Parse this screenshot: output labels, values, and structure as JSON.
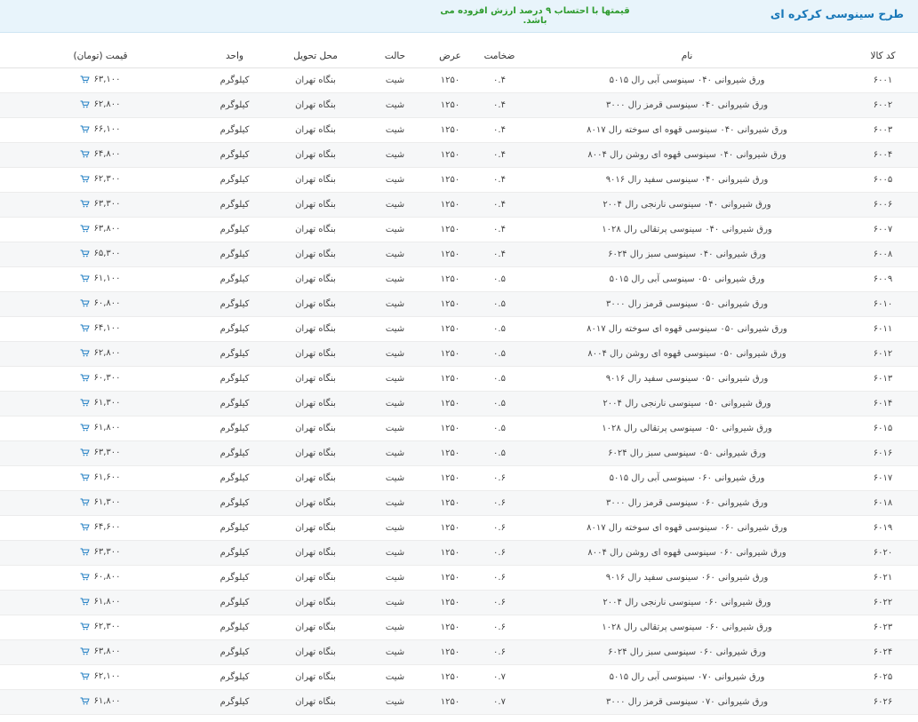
{
  "header": {
    "title": "طرح سینوسی کرکره ای",
    "note": "قیمتها با احتساب ۹ درصد ارزش افزوده می باشد."
  },
  "columns": {
    "code": "کد کالا",
    "name": "نام",
    "thickness": "ضخامت",
    "width": "عرض",
    "state": "حالت",
    "location": "محل تحویل",
    "unit": "واحد",
    "price": "قیمت (تومان)"
  },
  "colors": {
    "accent": "#1877b8",
    "note": "#2e9b2e",
    "header_bg": "#e8f4fb"
  },
  "icons": {
    "price_action": "cart-icon"
  },
  "rows": [
    {
      "code": "۶۰۰۱",
      "name": "ورق شیروانی ۰۴۰ سینوسی آبی رال ۵۰۱۵",
      "thickness": "۰.۴",
      "width": "۱۲۵۰",
      "state": "شیت",
      "location": "بنگاه تهران",
      "unit": "کیلوگرم",
      "price": "۶۳,۱۰۰"
    },
    {
      "code": "۶۰۰۲",
      "name": "ورق شیروانی ۰۴۰ سینوسی قرمز رال ۳۰۰۰",
      "thickness": "۰.۴",
      "width": "۱۲۵۰",
      "state": "شیت",
      "location": "بنگاه تهران",
      "unit": "کیلوگرم",
      "price": "۶۲,۸۰۰"
    },
    {
      "code": "۶۰۰۳",
      "name": "ورق شیروانی ۰۴۰ سینوسی قهوه ای سوخته رال ۸۰۱۷",
      "thickness": "۰.۴",
      "width": "۱۲۵۰",
      "state": "شیت",
      "location": "بنگاه تهران",
      "unit": "کیلوگرم",
      "price": "۶۶,۱۰۰"
    },
    {
      "code": "۶۰۰۴",
      "name": "ورق شیروانی ۰۴۰ سینوسی قهوه ای روشن رال ۸۰۰۴",
      "thickness": "۰.۴",
      "width": "۱۲۵۰",
      "state": "شیت",
      "location": "بنگاه تهران",
      "unit": "کیلوگرم",
      "price": "۶۴,۸۰۰"
    },
    {
      "code": "۶۰۰۵",
      "name": "ورق شیروانی ۰۴۰ سینوسی سفید رال ۹۰۱۶",
      "thickness": "۰.۴",
      "width": "۱۲۵۰",
      "state": "شیت",
      "location": "بنگاه تهران",
      "unit": "کیلوگرم",
      "price": "۶۲,۳۰۰"
    },
    {
      "code": "۶۰۰۶",
      "name": "ورق شیروانی ۰۴۰ سینوسی نارنجی رال ۲۰۰۴",
      "thickness": "۰.۴",
      "width": "۱۲۵۰",
      "state": "شیت",
      "location": "بنگاه تهران",
      "unit": "کیلوگرم",
      "price": "۶۳,۳۰۰"
    },
    {
      "code": "۶۰۰۷",
      "name": "ورق شیروانی ۰۴۰ سینوسی پرتقالی رال ۱۰۲۸",
      "thickness": "۰.۴",
      "width": "۱۲۵۰",
      "state": "شیت",
      "location": "بنگاه تهران",
      "unit": "کیلوگرم",
      "price": "۶۳,۸۰۰"
    },
    {
      "code": "۶۰۰۸",
      "name": "ورق شیروانی ۰۴۰ سینوسی سبز رال ۶۰۲۴",
      "thickness": "۰.۴",
      "width": "۱۲۵۰",
      "state": "شیت",
      "location": "بنگاه تهران",
      "unit": "کیلوگرم",
      "price": "۶۵,۳۰۰"
    },
    {
      "code": "۶۰۰۹",
      "name": "ورق شیروانی ۰۵۰ سینوسی آبی رال ۵۰۱۵",
      "thickness": "۰.۵",
      "width": "۱۲۵۰",
      "state": "شیت",
      "location": "بنگاه تهران",
      "unit": "کیلوگرم",
      "price": "۶۱,۱۰۰"
    },
    {
      "code": "۶۰۱۰",
      "name": "ورق شیروانی ۰۵۰ سینوسی قرمز رال ۳۰۰۰",
      "thickness": "۰.۵",
      "width": "۱۲۵۰",
      "state": "شیت",
      "location": "بنگاه تهران",
      "unit": "کیلوگرم",
      "price": "۶۰,۸۰۰"
    },
    {
      "code": "۶۰۱۱",
      "name": "ورق شیروانی ۰۵۰ سینوسی قهوه ای سوخته رال ۸۰۱۷",
      "thickness": "۰.۵",
      "width": "۱۲۵۰",
      "state": "شیت",
      "location": "بنگاه تهران",
      "unit": "کیلوگرم",
      "price": "۶۴,۱۰۰"
    },
    {
      "code": "۶۰۱۲",
      "name": "ورق شیروانی ۰۵۰ سینوسی قهوه ای روشن رال ۸۰۰۴",
      "thickness": "۰.۵",
      "width": "۱۲۵۰",
      "state": "شیت",
      "location": "بنگاه تهران",
      "unit": "کیلوگرم",
      "price": "۶۲,۸۰۰"
    },
    {
      "code": "۶۰۱۳",
      "name": "ورق شیروانی ۰۵۰ سینوسی سفید رال ۹۰۱۶",
      "thickness": "۰.۵",
      "width": "۱۲۵۰",
      "state": "شیت",
      "location": "بنگاه تهران",
      "unit": "کیلوگرم",
      "price": "۶۰,۳۰۰"
    },
    {
      "code": "۶۰۱۴",
      "name": "ورق شیروانی ۰۵۰ سینوسی نارنجی رال ۲۰۰۴",
      "thickness": "۰.۵",
      "width": "۱۲۵۰",
      "state": "شیت",
      "location": "بنگاه تهران",
      "unit": "کیلوگرم",
      "price": "۶۱,۳۰۰"
    },
    {
      "code": "۶۰۱۵",
      "name": "ورق شیروانی ۰۵۰ سینوسی پرتقالی رال ۱۰۲۸",
      "thickness": "۰.۵",
      "width": "۱۲۵۰",
      "state": "شیت",
      "location": "بنگاه تهران",
      "unit": "کیلوگرم",
      "price": "۶۱,۸۰۰"
    },
    {
      "code": "۶۰۱۶",
      "name": "ورق شیروانی ۰۵۰ سینوسی سبز رال ۶۰۲۴",
      "thickness": "۰.۵",
      "width": "۱۲۵۰",
      "state": "شیت",
      "location": "بنگاه تهران",
      "unit": "کیلوگرم",
      "price": "۶۳,۳۰۰"
    },
    {
      "code": "۶۰۱۷",
      "name": "ورق شیروانی ۰۶۰ سینوسی آبی رال ۵۰۱۵",
      "thickness": "۰.۶",
      "width": "۱۲۵۰",
      "state": "شیت",
      "location": "بنگاه تهران",
      "unit": "کیلوگرم",
      "price": "۶۱,۶۰۰"
    },
    {
      "code": "۶۰۱۸",
      "name": "ورق شیروانی ۰۶۰ سینوسی قرمز رال ۳۰۰۰",
      "thickness": "۰.۶",
      "width": "۱۲۵۰",
      "state": "شیت",
      "location": "بنگاه تهران",
      "unit": "کیلوگرم",
      "price": "۶۱,۳۰۰"
    },
    {
      "code": "۶۰۱۹",
      "name": "ورق شیروانی ۰۶۰ سینوسی قهوه ای سوخته رال ۸۰۱۷",
      "thickness": "۰.۶",
      "width": "۱۲۵۰",
      "state": "شیت",
      "location": "بنگاه تهران",
      "unit": "کیلوگرم",
      "price": "۶۴,۶۰۰"
    },
    {
      "code": "۶۰۲۰",
      "name": "ورق شیروانی ۰۶۰ سینوسی قهوه ای روشن رال ۸۰۰۴",
      "thickness": "۰.۶",
      "width": "۱۲۵۰",
      "state": "شیت",
      "location": "بنگاه تهران",
      "unit": "کیلوگرم",
      "price": "۶۳,۳۰۰"
    },
    {
      "code": "۶۰۲۱",
      "name": "ورق شیروانی ۰۶۰ سینوسی سفید رال ۹۰۱۶",
      "thickness": "۰.۶",
      "width": "۱۲۵۰",
      "state": "شیت",
      "location": "بنگاه تهران",
      "unit": "کیلوگرم",
      "price": "۶۰,۸۰۰"
    },
    {
      "code": "۶۰۲۲",
      "name": "ورق شیروانی ۰۶۰ سینوسی نارنجی رال ۲۰۰۴",
      "thickness": "۰.۶",
      "width": "۱۲۵۰",
      "state": "شیت",
      "location": "بنگاه تهران",
      "unit": "کیلوگرم",
      "price": "۶۱,۸۰۰"
    },
    {
      "code": "۶۰۲۳",
      "name": "ورق شیروانی ۰۶۰ سینوسی پرتقالی رال ۱۰۲۸",
      "thickness": "۰.۶",
      "width": "۱۲۵۰",
      "state": "شیت",
      "location": "بنگاه تهران",
      "unit": "کیلوگرم",
      "price": "۶۲,۳۰۰"
    },
    {
      "code": "۶۰۲۴",
      "name": "ورق شیروانی ۰۶۰ سینوسی سبز رال ۶۰۲۴",
      "thickness": "۰.۶",
      "width": "۱۲۵۰",
      "state": "شیت",
      "location": "بنگاه تهران",
      "unit": "کیلوگرم",
      "price": "۶۳,۸۰۰"
    },
    {
      "code": "۶۰۲۵",
      "name": "ورق شیروانی ۰۷۰ سینوسی آبی رال ۵۰۱۵",
      "thickness": "۰.۷",
      "width": "۱۲۵۰",
      "state": "شیت",
      "location": "بنگاه تهران",
      "unit": "کیلوگرم",
      "price": "۶۲,۱۰۰"
    },
    {
      "code": "۶۰۲۶",
      "name": "ورق شیروانی ۰۷۰ سینوسی قرمز رال ۳۰۰۰",
      "thickness": "۰.۷",
      "width": "۱۲۵۰",
      "state": "شیت",
      "location": "بنگاه تهران",
      "unit": "کیلوگرم",
      "price": "۶۱,۸۰۰"
    }
  ]
}
